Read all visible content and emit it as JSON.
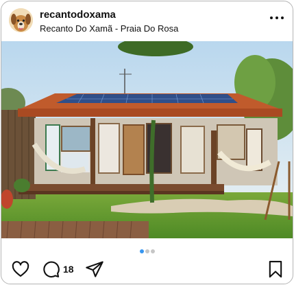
{
  "post": {
    "username": "recantodoxama",
    "location": "Recanto Do Xamã - Praia Do Rosa",
    "comment_count": "18"
  },
  "carousel": {
    "total": 3,
    "active": 1
  },
  "icons": {
    "more": "more-horizontal-icon",
    "like": "heart-icon",
    "comment": "comment-icon",
    "share": "paper-plane-icon",
    "save": "bookmark-icon"
  },
  "colors": {
    "carousel_active": "#3897f0",
    "carousel_inactive": "#c6c6c6",
    "text": "#111111"
  }
}
